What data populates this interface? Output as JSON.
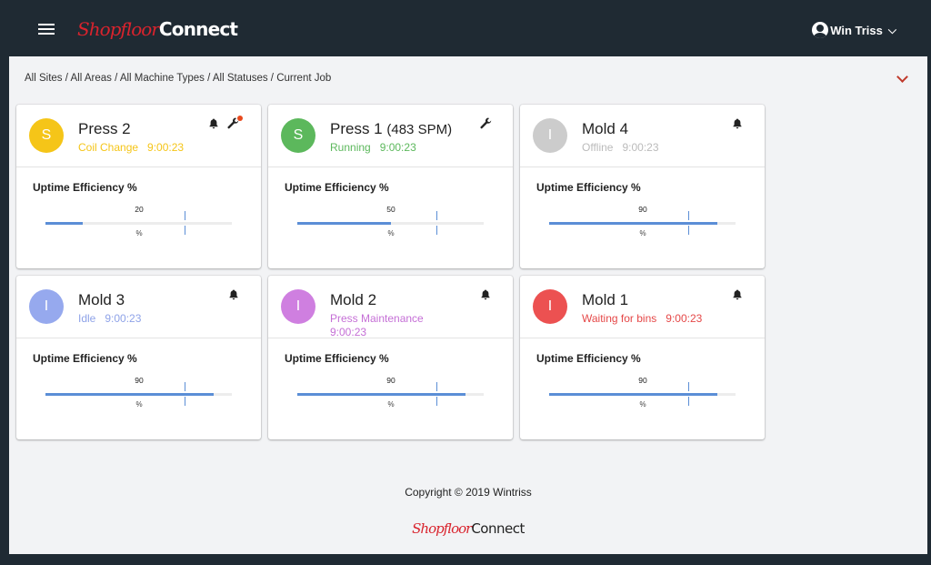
{
  "app": {
    "logo_shop": "Shopfloor",
    "logo_connect": "Connect",
    "user_name": "Win Triss",
    "icons": [
      "menu-icon",
      "user-circle-icon",
      "chevron-down-icon",
      "bell-icon",
      "wrench-icon"
    ]
  },
  "breadcrumb": "All Sites / All Areas / All Machine Types / All Statuses / Current Job",
  "colors": {
    "header_bg": "#1f2a33",
    "brand_red": "#d9232d",
    "setup": "#f5c518",
    "running": "#5cb85c",
    "offline": "#cccccc",
    "idle": "#96a9ee",
    "maintenance": "#cf7fe0",
    "waiting": "#ec5151",
    "bar": "#5b8ed6"
  },
  "cards": [
    {
      "name": "Press 2",
      "spm": "",
      "initial": "S",
      "circle_color": "#f5c518",
      "status": "Coil Change",
      "time": "9:00:23",
      "status_color": "#f5c518",
      "eff_title": "Uptime Efficiency %",
      "value": "20",
      "value_pct": 20,
      "unit": "%",
      "wrench": true,
      "alert_dot": true
    },
    {
      "name": "Press 1",
      "spm": "(483 SPM)",
      "initial": "S",
      "circle_color": "#5cb85c",
      "status": "Running",
      "time": "9:00:23",
      "status_color": "#5cb85c",
      "eff_title": "Uptime Efficiency %",
      "value": "50",
      "value_pct": 50,
      "unit": "%",
      "wrench": true,
      "alert_dot": false,
      "no_bell": true
    },
    {
      "name": "Mold 4",
      "spm": "",
      "initial": "I",
      "circle_color": "#cccccc",
      "status": "Offline",
      "time": "9:00:23",
      "status_color": "#bbbbbb",
      "eff_title": "Uptime Efficiency %",
      "value": "90",
      "value_pct": 90,
      "unit": "%",
      "wrench": false,
      "alert_dot": false
    },
    {
      "name": "Mold 3",
      "spm": "",
      "initial": "I",
      "circle_color": "#96a9ee",
      "status": "Idle",
      "time": "9:00:23",
      "status_color": "#8fa3e8",
      "eff_title": "Uptime Efficiency %",
      "value": "90",
      "value_pct": 90,
      "unit": "%",
      "wrench": false,
      "alert_dot": false
    },
    {
      "name": "Mold 2",
      "spm": "",
      "initial": "I",
      "circle_color": "#cf7fe0",
      "status": "Press Maintenance",
      "time": "9:00:23",
      "status_color": "#c56fd6",
      "eff_title": "Uptime Efficiency %",
      "value": "90",
      "value_pct": 90,
      "unit": "%",
      "wrench": false,
      "alert_dot": false,
      "wrap_time": true
    },
    {
      "name": "Mold 1",
      "spm": "",
      "initial": "I",
      "circle_color": "#ec5151",
      "status": "Waiting for bins",
      "time": "9:00:23",
      "status_color": "#e54848",
      "eff_title": "Uptime Efficiency %",
      "value": "90",
      "value_pct": 90,
      "unit": "%",
      "wrench": false,
      "alert_dot": false
    }
  ],
  "footer": {
    "copyright": "Copyright © 2019 Wintriss"
  }
}
